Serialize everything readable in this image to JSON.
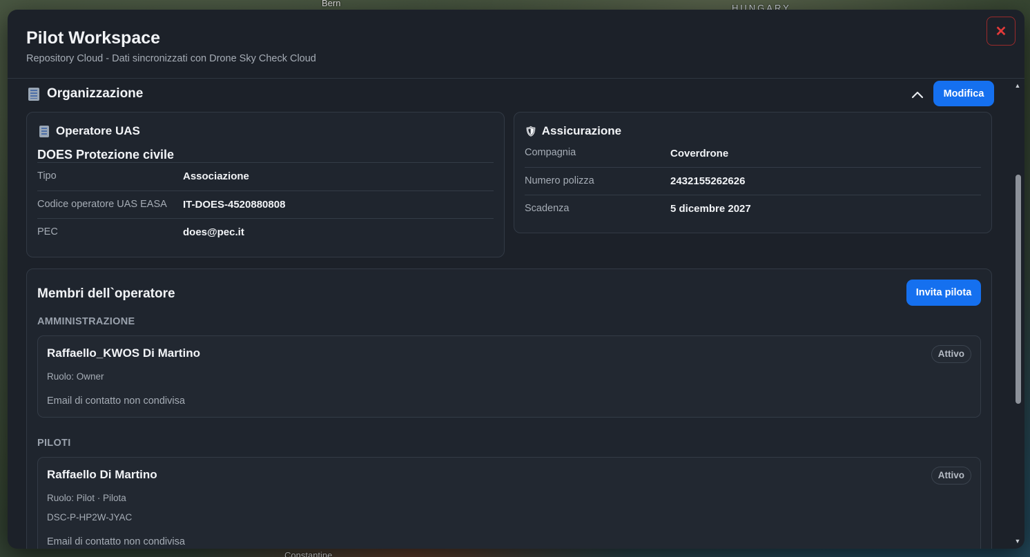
{
  "map": {
    "labels": {
      "bern": "Bern",
      "hungary": "HUNGARY",
      "bottom": "Constantine"
    }
  },
  "modal": {
    "title": "Pilot Workspace",
    "subtitle": "Repository Cloud - Dati sincronizzati con Drone Sky Check Cloud",
    "close_label": "✕"
  },
  "organizzazione": {
    "title": "Organizzazione",
    "edit_label": "Modifica",
    "operatore": {
      "title": "Operatore UAS",
      "name": "DOES Protezione civile",
      "rows": [
        {
          "label": "Tipo",
          "value": "Associazione"
        },
        {
          "label": "Codice operatore UAS EASA",
          "value": "IT-DOES-4520880808"
        },
        {
          "label": "PEC",
          "value": "does@pec.it"
        }
      ]
    },
    "assicurazione": {
      "icon": "🛡",
      "title": "Assicurazione",
      "rows": [
        {
          "label": "Compagnia",
          "value": "Coverdrone"
        },
        {
          "label": "Numero polizza",
          "value": "2432155262626"
        },
        {
          "label": "Scadenza",
          "value": "5 dicembre 2027"
        }
      ]
    }
  },
  "membri": {
    "title": "Membri dell`operatore",
    "invite_label": "Invita pilota",
    "groups": [
      {
        "label": "AMMINISTRAZIONE",
        "members": [
          {
            "name": "Raffaello_KWOS Di Martino",
            "role": "Ruolo: Owner",
            "email": "Email di contatto non condivisa",
            "status": "Attivo"
          }
        ]
      },
      {
        "label": "PILOTI",
        "members": [
          {
            "name": "Raffaello Di Martino",
            "role": "Ruolo: Pilot · Pilota",
            "code": "DSC-P-HP2W-JYAC",
            "email": "Email di contatto non condivisa",
            "status": "Attivo"
          }
        ]
      }
    ]
  },
  "colors": {
    "accent": "#1570ef",
    "danger": "#e23a3a",
    "modal_bg": "#1c2129"
  }
}
